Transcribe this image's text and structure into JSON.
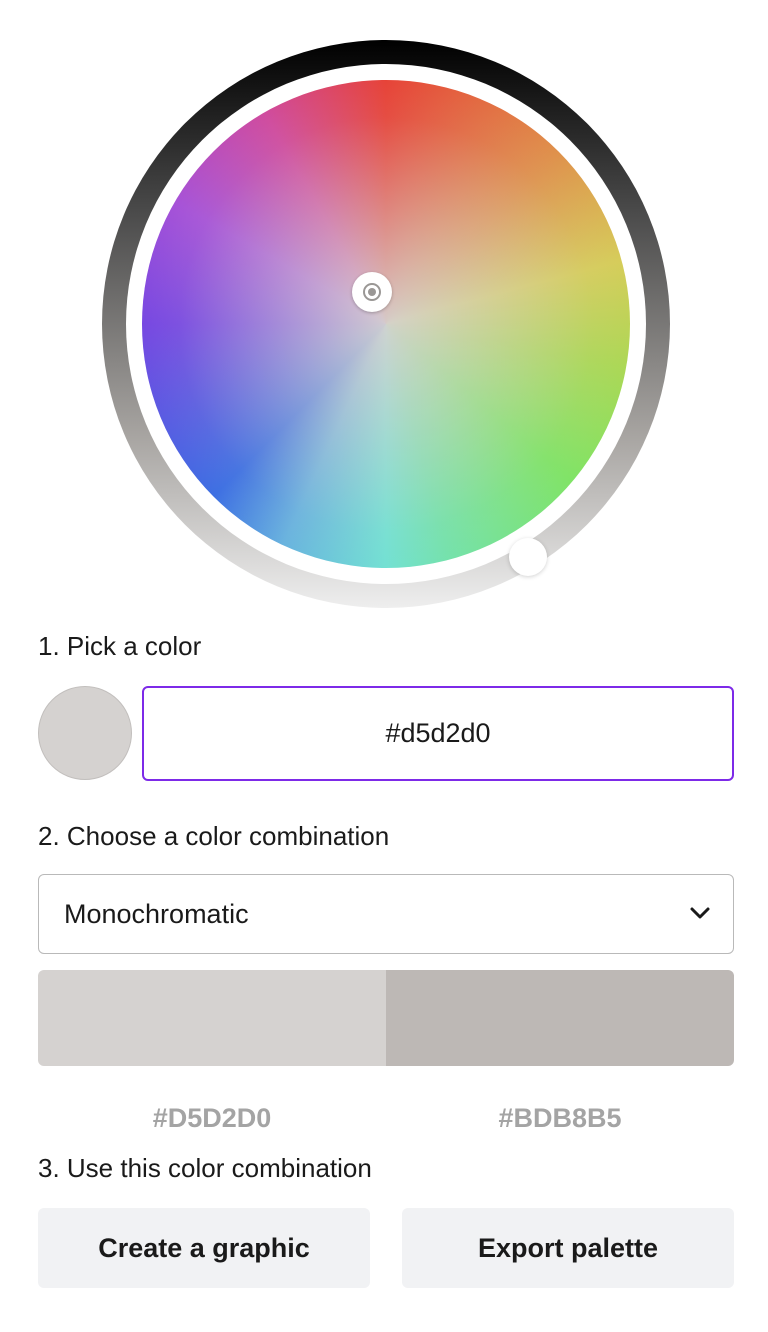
{
  "wheel": {
    "selected_color": "#d5d2d0"
  },
  "steps": {
    "pick": {
      "heading": "1. Pick a color",
      "swatch_color": "#d5d2d0",
      "hex_value": "#d5d2d0"
    },
    "combination": {
      "heading": "2. Choose a color combination",
      "selected": "Monochromatic",
      "chevron_icon": "chevron-down-icon"
    },
    "use": {
      "heading": "3. Use this color combination",
      "create_label": "Create a graphic",
      "export_label": "Export palette"
    }
  },
  "palette": {
    "swatches": [
      {
        "color": "#d5d2d0",
        "label": "#D5D2D0"
      },
      {
        "color": "#bdb8b5",
        "label": "#BDB8B5"
      }
    ]
  },
  "colors": {
    "accent": "#7d2ae8",
    "palette_code_text": "#a4a4a4",
    "button_bg": "#f1f2f4"
  }
}
